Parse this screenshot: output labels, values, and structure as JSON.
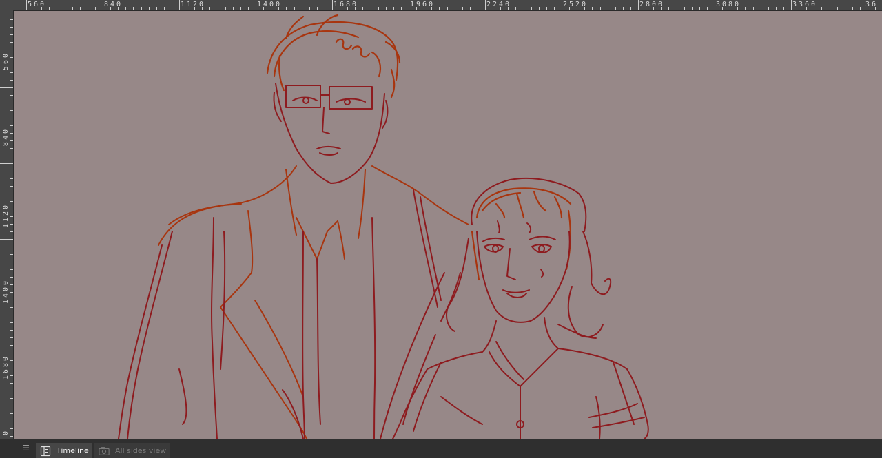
{
  "ruler": {
    "top_labels": [
      "560",
      "840",
      "1120",
      "1400",
      "1680",
      "1960",
      "2240",
      "2520",
      "2800",
      "3080",
      "3360",
      "36"
    ],
    "left_labels": [
      "560",
      "840",
      "1120",
      "1400",
      "1680",
      "0"
    ]
  },
  "canvas": {
    "background_color": "#978888",
    "stroke_colors": [
      "#8e1b1f",
      "#a8350f"
    ]
  },
  "bottom_bar": {
    "menu_icon": "hamburger-icon",
    "tabs": [
      {
        "label": "Timeline",
        "icon": "timeline-icon",
        "active": true
      },
      {
        "label": "All sides view",
        "icon": "camera-icon",
        "active": false
      }
    ]
  }
}
